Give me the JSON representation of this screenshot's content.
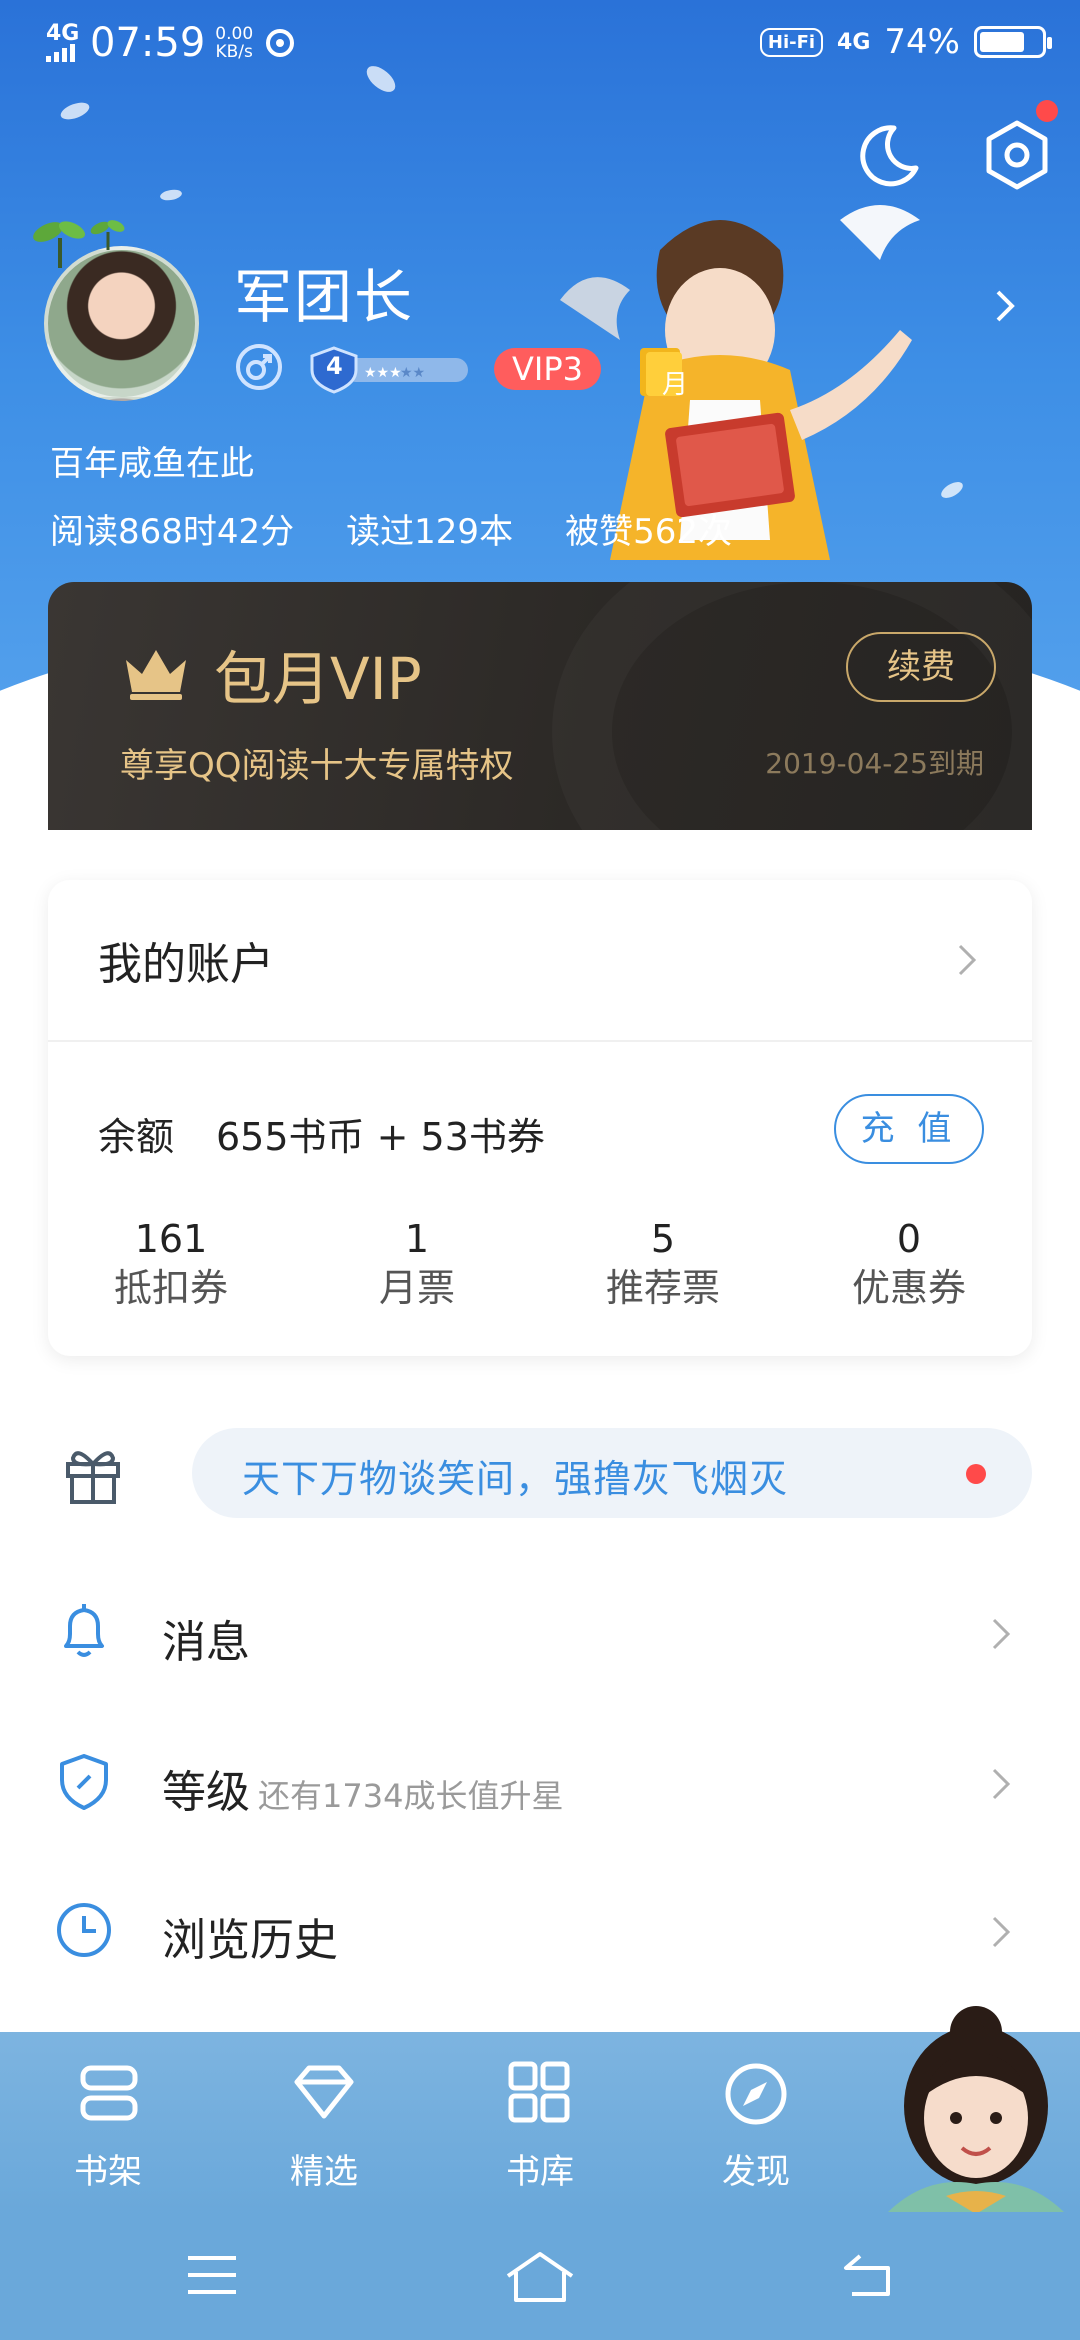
{
  "status_bar": {
    "network": "4G",
    "time": "07:59",
    "speed_value": "0.00",
    "speed_unit": "KB/s",
    "hifi": "Hi-Fi",
    "network_right": "4G",
    "battery_text": "74%",
    "battery_level": 0.74
  },
  "profile": {
    "username": "军团长",
    "level": "4",
    "vip_badge": "VIP3",
    "month_badge": "月",
    "signature": "百年咸鱼在此",
    "stats": [
      "阅读868时42分",
      "读过129本",
      "被赞562次"
    ]
  },
  "vip_card": {
    "title": "包月VIP",
    "description": "尊享QQ阅读十大专属特权",
    "expire": "2019-04-25到期",
    "renew_label": "续费"
  },
  "account": {
    "title": "我的账户",
    "balance_label": "余额",
    "balance_value": "655书币 + 53书券",
    "recharge_label": "充 值",
    "counters": [
      {
        "num": "161",
        "label": "抵扣券"
      },
      {
        "num": "1",
        "label": "月票"
      },
      {
        "num": "5",
        "label": "推荐票"
      },
      {
        "num": "0",
        "label": "优惠券"
      }
    ]
  },
  "banner": {
    "text": "天下万物谈笑间，强撸灰飞烟灭"
  },
  "menu": [
    {
      "label": "消息",
      "sub": "",
      "icon": "bell-icon"
    },
    {
      "label": "等级",
      "sub": "还有1734成长值升星",
      "icon": "shield-icon"
    },
    {
      "label": "浏览历史",
      "sub": "",
      "icon": "clock-icon"
    }
  ],
  "tabs": [
    {
      "label": "书架",
      "icon": "bookshelf-icon"
    },
    {
      "label": "精选",
      "icon": "diamond-icon"
    },
    {
      "label": "书库",
      "icon": "grid-icon"
    },
    {
      "label": "发现",
      "icon": "compass-icon"
    }
  ],
  "colors": {
    "header_blue": "#3e8fe6",
    "vip_gold": "#e6c487",
    "accent_blue": "#3a8ee0",
    "alert_red": "#ff4a4a",
    "tabbar_blue": "#7db4e0"
  }
}
